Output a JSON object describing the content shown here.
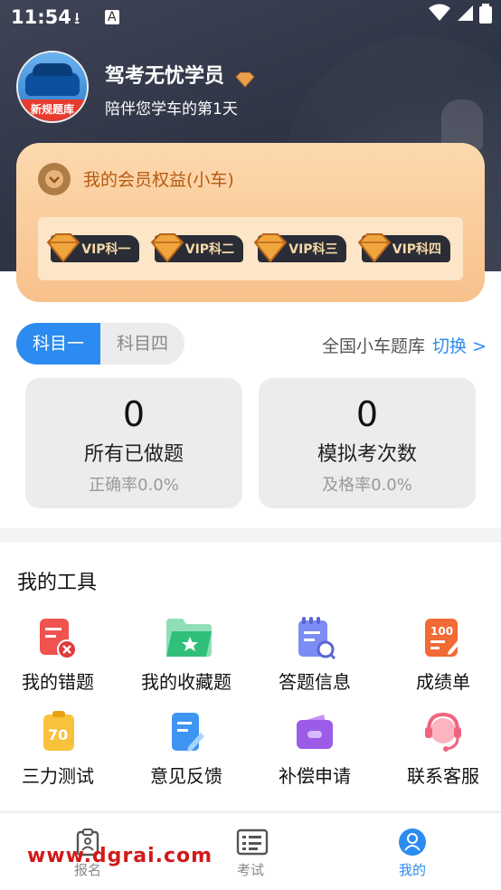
{
  "status_bar": {
    "time": "11:54"
  },
  "profile": {
    "avatar_band_text": "新规题库",
    "username": "驾考无忧学员",
    "subtitle": "陪伴您学车的第1天"
  },
  "vip": {
    "title": "我的会员权益(小车)",
    "badges": [
      "VIP科一",
      "VIP科二",
      "VIP科三",
      "VIP科四"
    ]
  },
  "subjects": {
    "tabs": [
      "科目一",
      "科目四"
    ],
    "active_index": 0,
    "bank_label": "全国小车题库",
    "switch_label": "切换 >"
  },
  "stats": [
    {
      "value": "0",
      "label": "所有已做题",
      "rate": "正确率0.0%"
    },
    {
      "value": "0",
      "label": "模拟考次数",
      "rate": "及格率0.0%"
    }
  ],
  "tools": {
    "heading": "我的工具",
    "items": [
      {
        "label": "我的错题",
        "icon": "wrong-questions-icon"
      },
      {
        "label": "我的收藏题",
        "icon": "favorites-folder-icon"
      },
      {
        "label": "答题信息",
        "icon": "answer-info-icon"
      },
      {
        "label": "成绩单",
        "icon": "score-sheet-icon"
      },
      {
        "label": "三力测试",
        "icon": "three-ability-test-icon"
      },
      {
        "label": "意见反馈",
        "icon": "feedback-icon"
      },
      {
        "label": "补偿申请",
        "icon": "compensation-wallet-icon"
      },
      {
        "label": "联系客服",
        "icon": "customer-service-icon"
      }
    ]
  },
  "bottom_nav": {
    "items": [
      {
        "label": "报名",
        "icon": "signup-icon"
      },
      {
        "label": "考试",
        "icon": "exam-icon"
      },
      {
        "label": "我的",
        "icon": "profile-icon"
      }
    ],
    "active_index": 2
  },
  "watermark": "www.dgrai.com",
  "colors": {
    "accent": "#2b8bf0",
    "vip_card": "#f8c18c",
    "header": "#2e3344"
  }
}
